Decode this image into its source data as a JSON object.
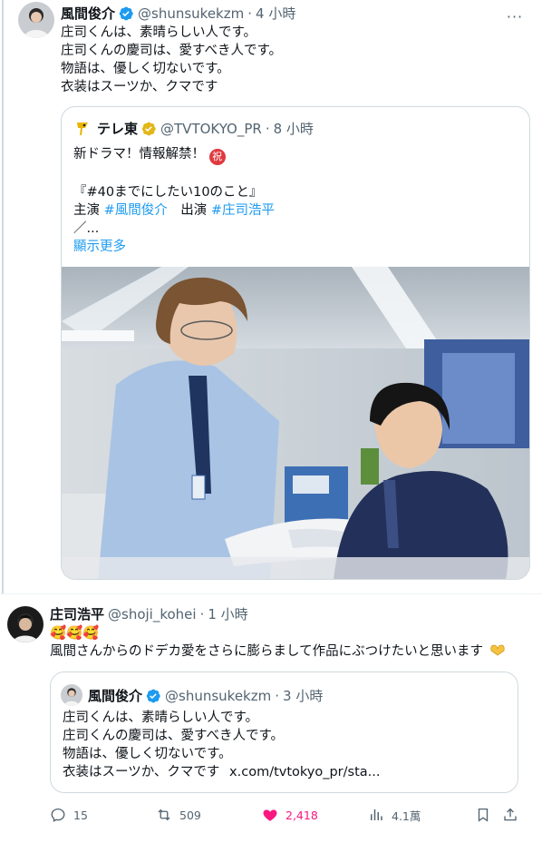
{
  "tweet1": {
    "author": "風間俊介",
    "handle": "@shunsukekzm",
    "time": "4 小時",
    "more_label": "···",
    "lines": [
      "庄司くんは、素晴らしい人です。",
      "庄司くんの慶司は、愛すべき人です。",
      "物語は、優しく切ないです。",
      "衣装はスーツか、クマです"
    ],
    "quote": {
      "author": "テレ東",
      "handle": "@TVTOKYO_PR",
      "time": "8 小時",
      "line1": "新ドラマ！情報解禁！",
      "celebration_char": "祝",
      "line2": "『#40までにしたい10のこと』",
      "line3_prefix": "主演 ",
      "line3_tag1": "#風間俊介",
      "line3_middle": "　出演 ",
      "line3_tag2": "#庄司浩平",
      "line4": "／...",
      "show_more": "顯示更多"
    }
  },
  "tweet2": {
    "author": "庄司浩平",
    "handle": "@shoji_kohei",
    "time": "1 小時",
    "emoji_line": "🥰🥰🥰",
    "text": "風間さんからのドデカ愛をさらに膨らまして作品にぶつけたいと思います",
    "quote": {
      "author": "風間俊介",
      "handle": "@shunsukekzm",
      "time": "3 小時",
      "lines": [
        "庄司くんは、素晴らしい人です。",
        "庄司くんの慶司は、愛すべき人です。",
        "物語は、優しく切ないです。"
      ],
      "last_line": "衣装はスーツか、クマです",
      "link": "x.com/tvtokyo_pr/sta..."
    },
    "actions": {
      "replies": "15",
      "retweets": "509",
      "likes": "2,418",
      "views": "4.1萬"
    }
  },
  "colors": {
    "accent": "#1d9bf0",
    "like": "#f91880",
    "verified_blue": "#1d9bf0",
    "verified_gold": "#e2b719",
    "muted": "#536471"
  }
}
